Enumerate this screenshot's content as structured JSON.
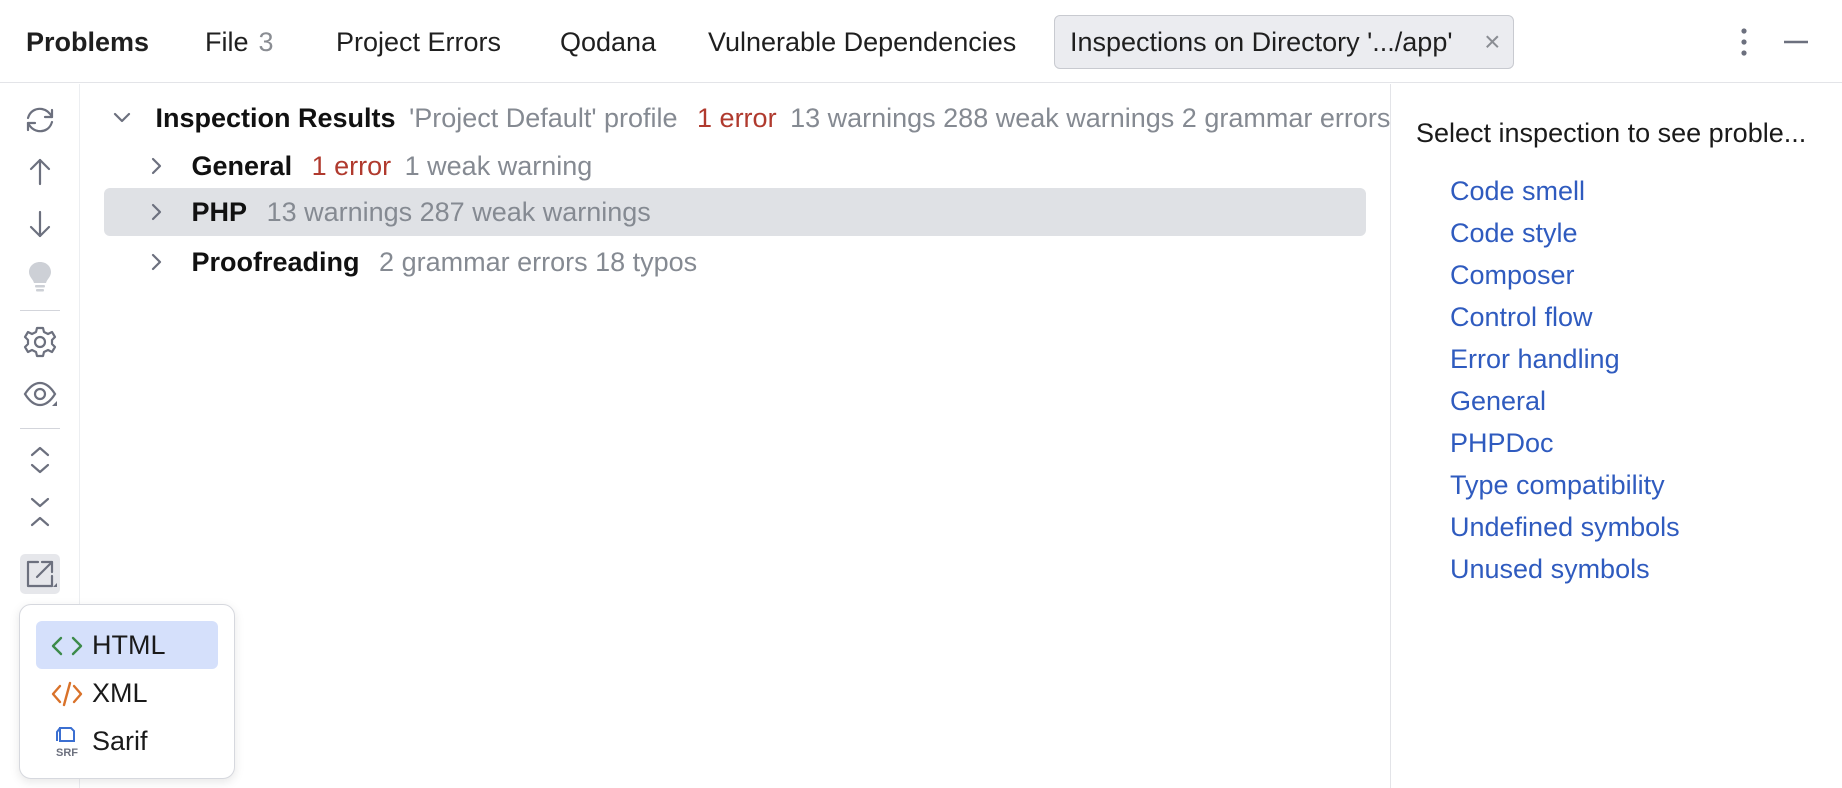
{
  "tabs": {
    "title": "Problems",
    "file_label": "File",
    "file_count": "3",
    "project_errors": "Project Errors",
    "qodana": "Qodana",
    "vulnerable": "Vulnerable Dependencies",
    "active_label": "Inspections on Directory '.../app'",
    "close_glyph": "×"
  },
  "tree": {
    "root": {
      "label": "Inspection Results",
      "profile": "'Project Default' profile",
      "errors": "1 error",
      "summary": "13 warnings 288 weak warnings 2 grammar errors"
    },
    "items": [
      {
        "label": "General",
        "error": "1 error",
        "info": "1 weak warning"
      },
      {
        "label": "PHP",
        "error": "",
        "info": "13 warnings 287 weak warnings",
        "selected": true
      },
      {
        "label": "Proofreading",
        "error": "",
        "info": "2 grammar errors 18 typos"
      }
    ]
  },
  "details": {
    "heading": "Select inspection to see proble...",
    "links": [
      "Code smell",
      "Code style",
      "Composer",
      "Control flow",
      "Error handling",
      "General",
      "PHPDoc",
      "Type compatibility",
      "Undefined symbols",
      "Unused symbols"
    ]
  },
  "export_menu": {
    "items": [
      {
        "label": "HTML",
        "icon": "html-icon",
        "highlighted": true
      },
      {
        "label": "XML",
        "icon": "xml-icon"
      },
      {
        "label": "Sarif",
        "icon": "sarif-icon",
        "icon_text": "SRF"
      }
    ]
  },
  "colors": {
    "error": "#b03a2e",
    "link": "#2f5bbf",
    "muted": "#858a92",
    "selection": "#dfe1e5",
    "menu_highlight": "#d5e0fb"
  }
}
